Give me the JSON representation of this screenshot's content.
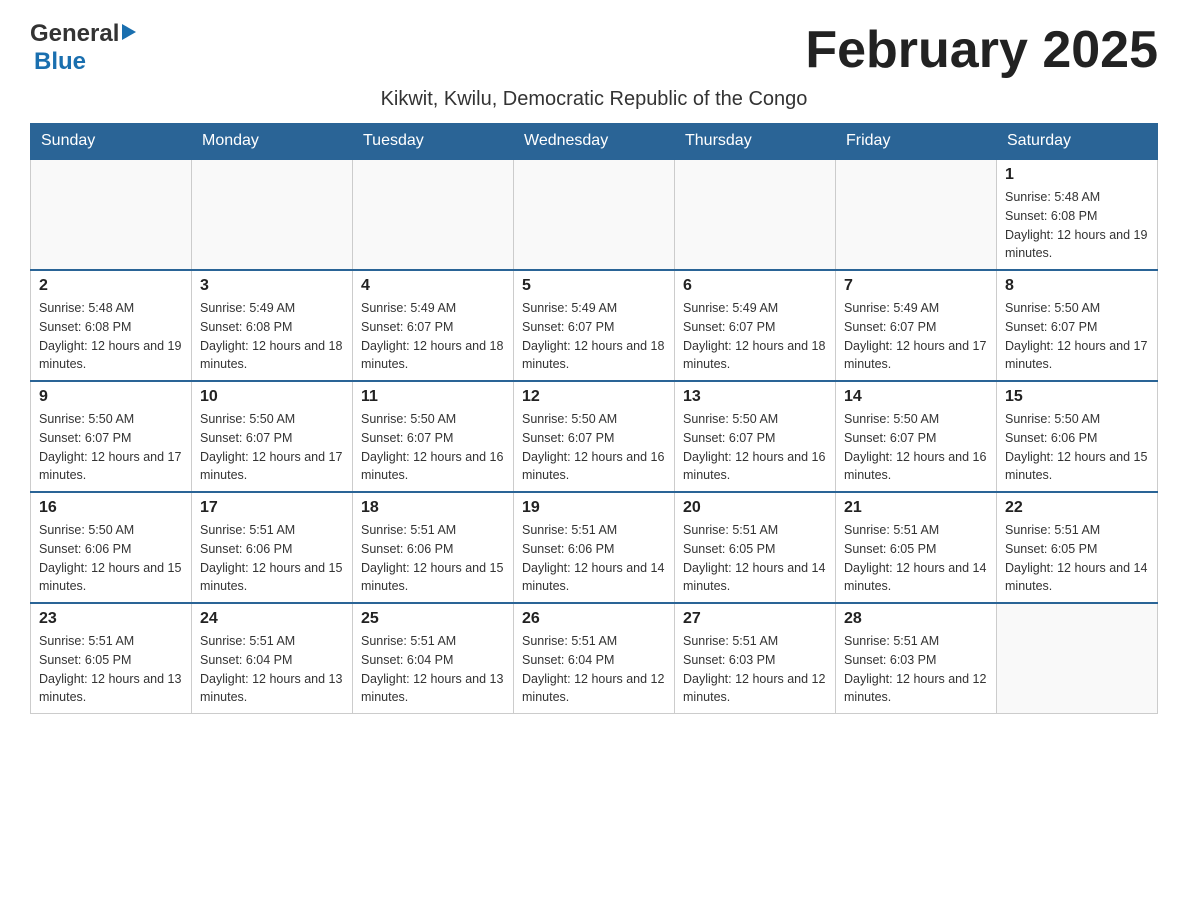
{
  "header": {
    "logo_general": "General",
    "logo_blue": "Blue",
    "month_title": "February 2025",
    "subtitle": "Kikwit, Kwilu, Democratic Republic of the Congo"
  },
  "days_of_week": [
    "Sunday",
    "Monday",
    "Tuesday",
    "Wednesday",
    "Thursday",
    "Friday",
    "Saturday"
  ],
  "weeks": [
    {
      "days": [
        {
          "number": "",
          "info": ""
        },
        {
          "number": "",
          "info": ""
        },
        {
          "number": "",
          "info": ""
        },
        {
          "number": "",
          "info": ""
        },
        {
          "number": "",
          "info": ""
        },
        {
          "number": "",
          "info": ""
        },
        {
          "number": "1",
          "info": "Sunrise: 5:48 AM\nSunset: 6:08 PM\nDaylight: 12 hours and 19 minutes."
        }
      ]
    },
    {
      "days": [
        {
          "number": "2",
          "info": "Sunrise: 5:48 AM\nSunset: 6:08 PM\nDaylight: 12 hours and 19 minutes."
        },
        {
          "number": "3",
          "info": "Sunrise: 5:49 AM\nSunset: 6:08 PM\nDaylight: 12 hours and 18 minutes."
        },
        {
          "number": "4",
          "info": "Sunrise: 5:49 AM\nSunset: 6:07 PM\nDaylight: 12 hours and 18 minutes."
        },
        {
          "number": "5",
          "info": "Sunrise: 5:49 AM\nSunset: 6:07 PM\nDaylight: 12 hours and 18 minutes."
        },
        {
          "number": "6",
          "info": "Sunrise: 5:49 AM\nSunset: 6:07 PM\nDaylight: 12 hours and 18 minutes."
        },
        {
          "number": "7",
          "info": "Sunrise: 5:49 AM\nSunset: 6:07 PM\nDaylight: 12 hours and 17 minutes."
        },
        {
          "number": "8",
          "info": "Sunrise: 5:50 AM\nSunset: 6:07 PM\nDaylight: 12 hours and 17 minutes."
        }
      ]
    },
    {
      "days": [
        {
          "number": "9",
          "info": "Sunrise: 5:50 AM\nSunset: 6:07 PM\nDaylight: 12 hours and 17 minutes."
        },
        {
          "number": "10",
          "info": "Sunrise: 5:50 AM\nSunset: 6:07 PM\nDaylight: 12 hours and 17 minutes."
        },
        {
          "number": "11",
          "info": "Sunrise: 5:50 AM\nSunset: 6:07 PM\nDaylight: 12 hours and 16 minutes."
        },
        {
          "number": "12",
          "info": "Sunrise: 5:50 AM\nSunset: 6:07 PM\nDaylight: 12 hours and 16 minutes."
        },
        {
          "number": "13",
          "info": "Sunrise: 5:50 AM\nSunset: 6:07 PM\nDaylight: 12 hours and 16 minutes."
        },
        {
          "number": "14",
          "info": "Sunrise: 5:50 AM\nSunset: 6:07 PM\nDaylight: 12 hours and 16 minutes."
        },
        {
          "number": "15",
          "info": "Sunrise: 5:50 AM\nSunset: 6:06 PM\nDaylight: 12 hours and 15 minutes."
        }
      ]
    },
    {
      "days": [
        {
          "number": "16",
          "info": "Sunrise: 5:50 AM\nSunset: 6:06 PM\nDaylight: 12 hours and 15 minutes."
        },
        {
          "number": "17",
          "info": "Sunrise: 5:51 AM\nSunset: 6:06 PM\nDaylight: 12 hours and 15 minutes."
        },
        {
          "number": "18",
          "info": "Sunrise: 5:51 AM\nSunset: 6:06 PM\nDaylight: 12 hours and 15 minutes."
        },
        {
          "number": "19",
          "info": "Sunrise: 5:51 AM\nSunset: 6:06 PM\nDaylight: 12 hours and 14 minutes."
        },
        {
          "number": "20",
          "info": "Sunrise: 5:51 AM\nSunset: 6:05 PM\nDaylight: 12 hours and 14 minutes."
        },
        {
          "number": "21",
          "info": "Sunrise: 5:51 AM\nSunset: 6:05 PM\nDaylight: 12 hours and 14 minutes."
        },
        {
          "number": "22",
          "info": "Sunrise: 5:51 AM\nSunset: 6:05 PM\nDaylight: 12 hours and 14 minutes."
        }
      ]
    },
    {
      "days": [
        {
          "number": "23",
          "info": "Sunrise: 5:51 AM\nSunset: 6:05 PM\nDaylight: 12 hours and 13 minutes."
        },
        {
          "number": "24",
          "info": "Sunrise: 5:51 AM\nSunset: 6:04 PM\nDaylight: 12 hours and 13 minutes."
        },
        {
          "number": "25",
          "info": "Sunrise: 5:51 AM\nSunset: 6:04 PM\nDaylight: 12 hours and 13 minutes."
        },
        {
          "number": "26",
          "info": "Sunrise: 5:51 AM\nSunset: 6:04 PM\nDaylight: 12 hours and 12 minutes."
        },
        {
          "number": "27",
          "info": "Sunrise: 5:51 AM\nSunset: 6:03 PM\nDaylight: 12 hours and 12 minutes."
        },
        {
          "number": "28",
          "info": "Sunrise: 5:51 AM\nSunset: 6:03 PM\nDaylight: 12 hours and 12 minutes."
        },
        {
          "number": "",
          "info": ""
        }
      ]
    }
  ]
}
